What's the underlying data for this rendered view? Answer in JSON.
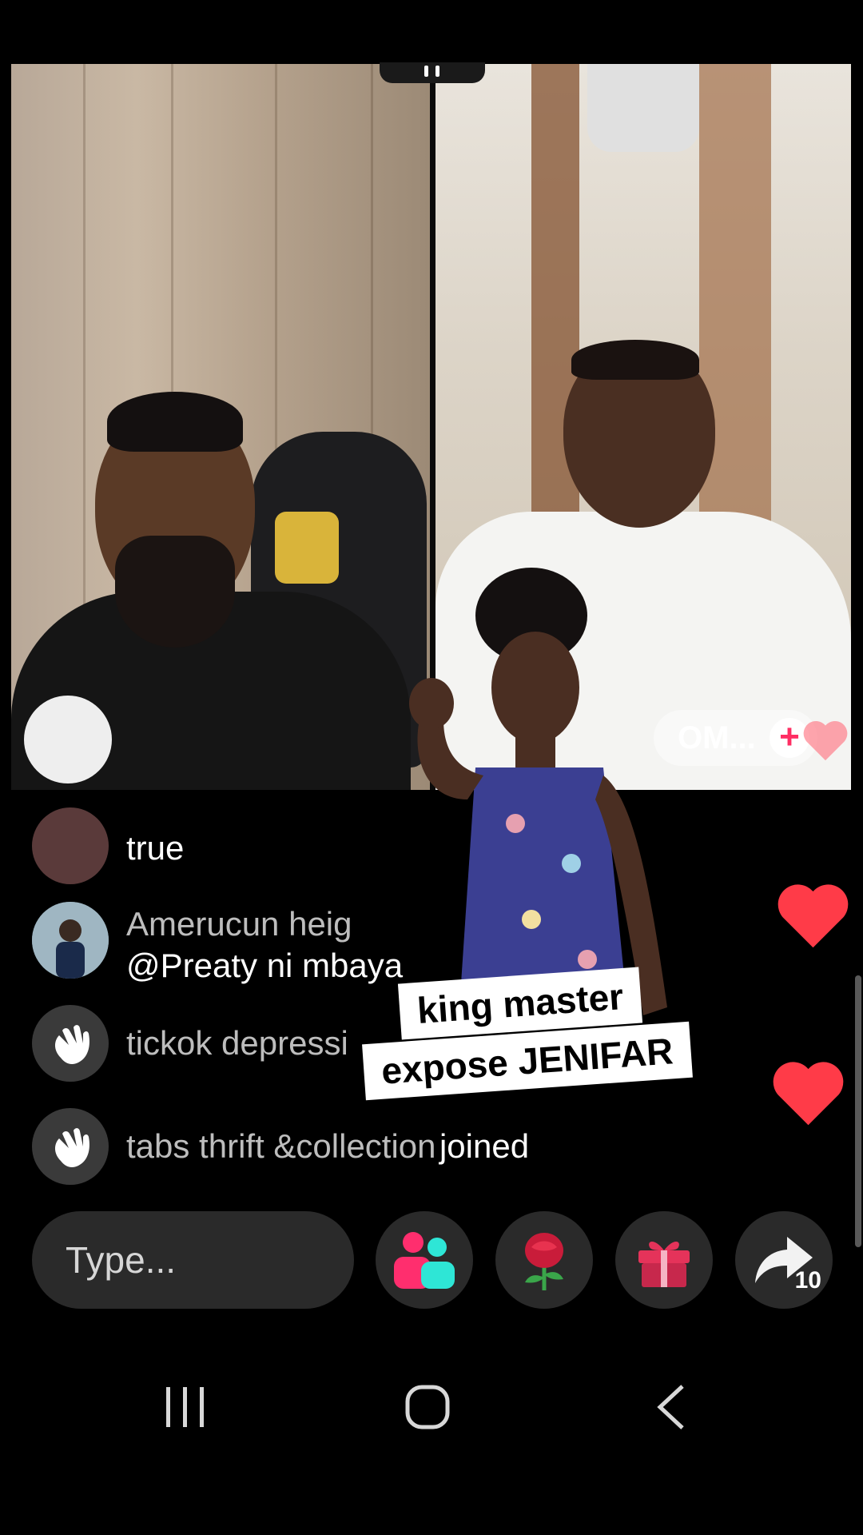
{
  "stream": {
    "guest_name": "OM...",
    "follow_symbol": "+"
  },
  "comments": [
    {
      "name": "",
      "text": "true"
    },
    {
      "name": "Amerucun heig",
      "text": "@Preaty ni mbaya"
    },
    {
      "name": "tickok depressi",
      "text": ""
    },
    {
      "name": "tabs thrift &collection",
      "text": "joined"
    }
  ],
  "caption": {
    "line1": "king master",
    "line2": "expose JENIFAR"
  },
  "bottom_bar": {
    "input_placeholder": "Type...",
    "share_count": "10"
  },
  "colors": {
    "heart": "#ff3b48",
    "accent_pink": "#ff2e6e",
    "accent_cyan": "#2ee6d6",
    "gift_pink": "#e5335a"
  },
  "icons": [
    "multi-guest-icon",
    "rose-icon",
    "gift-icon",
    "share-icon",
    "wave-icon",
    "heart-icon"
  ]
}
